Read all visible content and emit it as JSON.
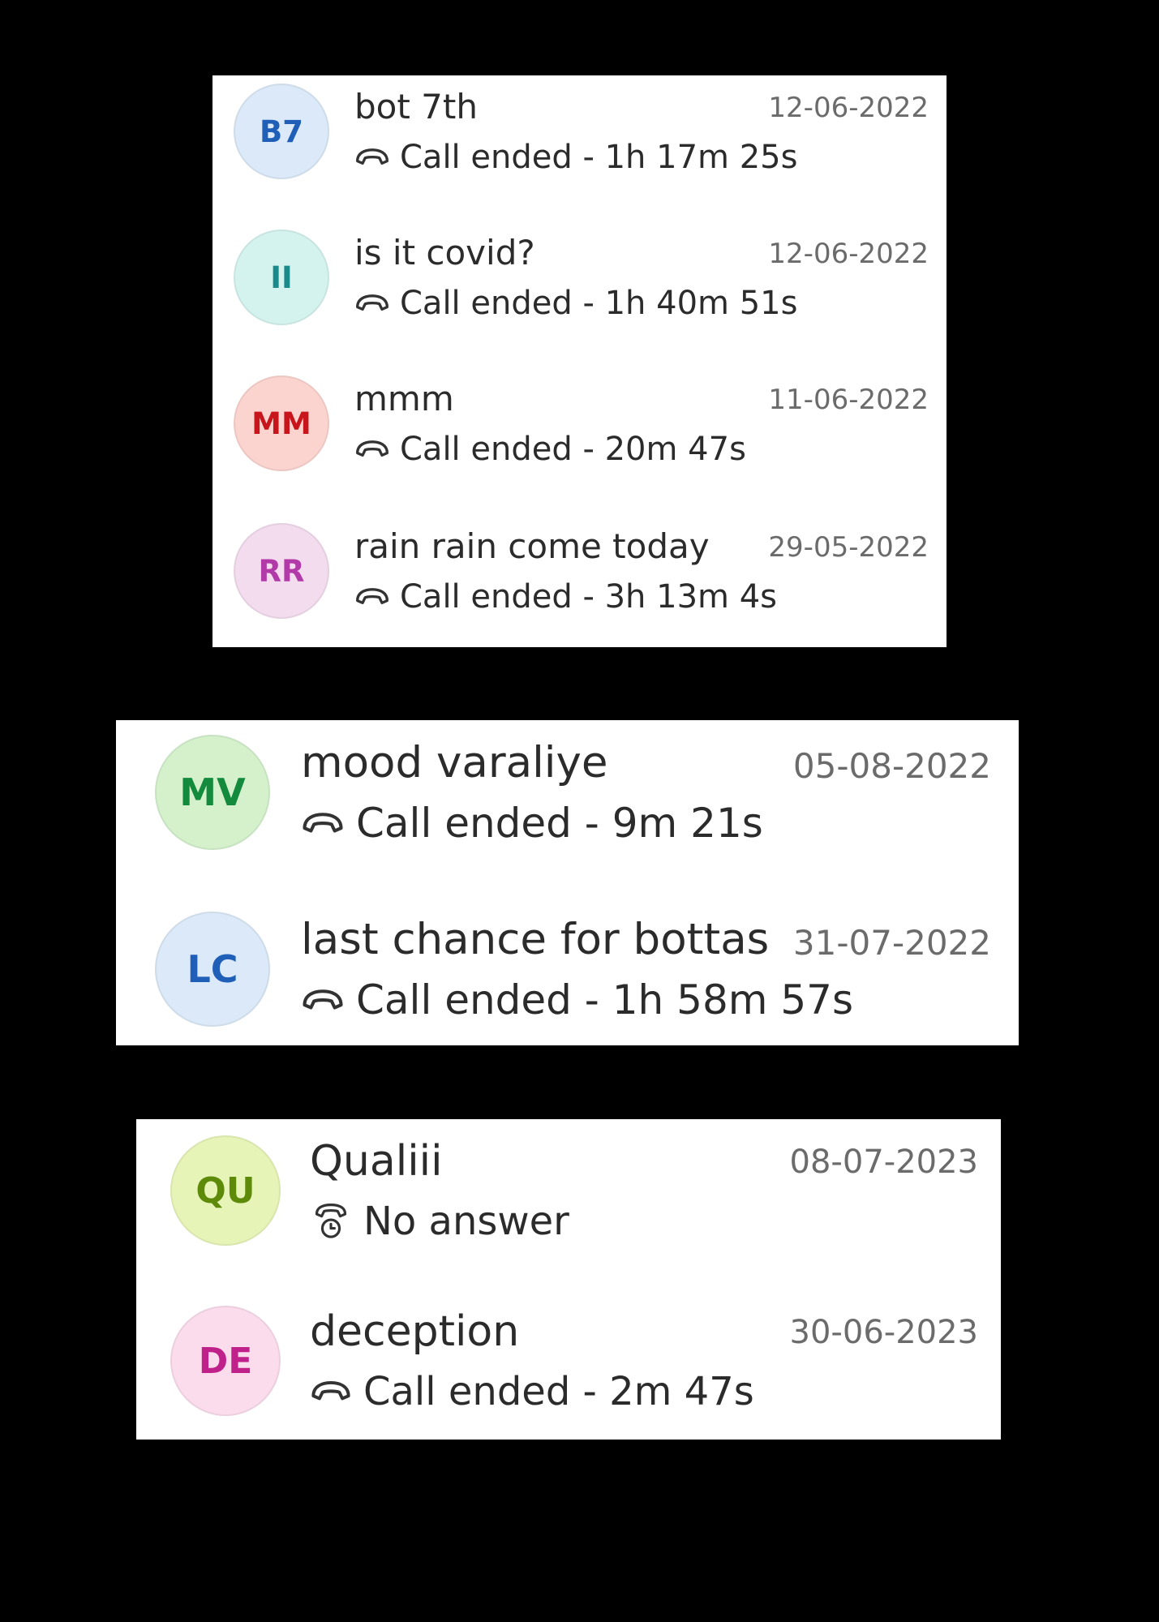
{
  "colors": {
    "background": "#000000",
    "panel": "#ffffff",
    "title_text": "#2b2b2b",
    "date_text": "#6b6b6b"
  },
  "icons": {
    "call_ended": "phone-hangup-icon",
    "no_answer": "phone-missed-icon"
  },
  "panels": [
    {
      "items": [
        {
          "initials": "B7",
          "title": "bot 7th",
          "status": "Call ended - 1h 17m 25s",
          "status_icon": "phone-hangup-icon",
          "date": "12-06-2022",
          "avatar_bg": "#dbe9f8",
          "avatar_fg": "#1f5fb8"
        },
        {
          "initials": "II",
          "title": "is it covid?",
          "status": "Call ended - 1h 40m 51s",
          "status_icon": "phone-hangup-icon",
          "date": "12-06-2022",
          "avatar_bg": "#d5f3ee",
          "avatar_fg": "#1a8a8a"
        },
        {
          "initials": "MM",
          "title": "mmm",
          "status": "Call ended - 20m 47s",
          "status_icon": "phone-hangup-icon",
          "date": "11-06-2022",
          "avatar_bg": "#fbd4cf",
          "avatar_fg": "#c8151b"
        },
        {
          "initials": "RR",
          "title": "rain rain come today",
          "status": "Call ended - 3h 13m 4s",
          "status_icon": "phone-hangup-icon",
          "date": "29-05-2022",
          "avatar_bg": "#f3dcee",
          "avatar_fg": "#b23aa8"
        }
      ]
    },
    {
      "items": [
        {
          "initials": "MV",
          "title": "mood varaliye",
          "status": "Call ended - 9m 21s",
          "status_icon": "phone-hangup-icon",
          "date": "05-08-2022",
          "avatar_bg": "#d4f1cc",
          "avatar_fg": "#138a3c"
        },
        {
          "initials": "LC",
          "title": "last chance for bottas",
          "status": "Call ended - 1h 58m 57s",
          "status_icon": "phone-hangup-icon",
          "date": "31-07-2022",
          "avatar_bg": "#dbe9f8",
          "avatar_fg": "#1f5fb8"
        }
      ]
    },
    {
      "items": [
        {
          "initials": "QU",
          "title": "Qualiii",
          "status": "No answer",
          "status_icon": "phone-missed-icon",
          "date": "08-07-2023",
          "avatar_bg": "#e6f4b8",
          "avatar_fg": "#5e8a0a"
        },
        {
          "initials": "DE",
          "title": "deception",
          "status": "Call ended - 2m 47s",
          "status_icon": "phone-hangup-icon",
          "date": "30-06-2023",
          "avatar_bg": "#fbdcec",
          "avatar_fg": "#c0208a"
        }
      ]
    }
  ]
}
